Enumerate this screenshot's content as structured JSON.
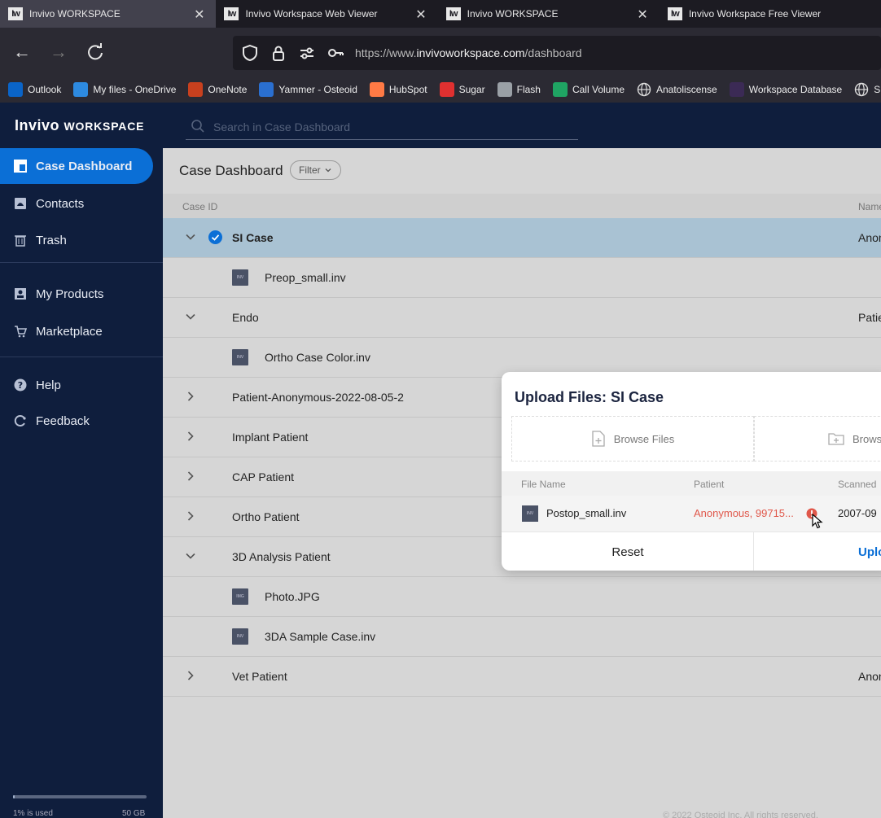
{
  "browser": {
    "tabs": [
      {
        "favicon": "Iw",
        "label": "Invivo WORKSPACE",
        "active": true
      },
      {
        "favicon": "Iw",
        "label": "Invivo Workspace Web Viewer",
        "active": false
      },
      {
        "favicon": "Iw",
        "label": "Invivo WORKSPACE",
        "active": false
      },
      {
        "favicon": "Iw",
        "label": "Invivo Workspace Free Viewer",
        "active": false
      }
    ],
    "url_prefix": "https://www.",
    "url_domain": "invivoworkspace.com",
    "url_path": "/dashboard",
    "bookmarks": [
      {
        "label": "Outlook",
        "color": "#0a64c8",
        "icon": "outlook-icon"
      },
      {
        "label": "My files - OneDrive",
        "color": "#2d8ae0",
        "icon": "onedrive-icon"
      },
      {
        "label": "OneNote",
        "color": "#c8401e",
        "icon": "onenote-icon"
      },
      {
        "label": "Yammer - Osteoid",
        "color": "#2a6fd0",
        "icon": "yammer-icon"
      },
      {
        "label": "HubSpot",
        "color": "#ff7a45",
        "icon": "hubspot-icon"
      },
      {
        "label": "Sugar",
        "color": "#e03030",
        "icon": "sugar-icon"
      },
      {
        "label": "Flash",
        "color": "#9aa0a6",
        "icon": "flash-icon"
      },
      {
        "label": "Call Volume",
        "color": "#1fa463",
        "icon": "sheets-icon"
      },
      {
        "label": "Anatoliscense",
        "color": "transparent",
        "icon": "globe-icon"
      },
      {
        "label": "Workspace Database",
        "color": "#3b2a55",
        "icon": "database-icon"
      },
      {
        "label": "Surg",
        "color": "transparent",
        "icon": "globe-icon"
      }
    ]
  },
  "app": {
    "logo_main": "Invivo",
    "logo_sub": "WORKSPACE",
    "search_placeholder": "Search in Case Dashboard"
  },
  "sidebar": {
    "items": [
      {
        "label": "Case Dashboard",
        "icon": "dashboard-icon",
        "active": true
      },
      {
        "label": "Contacts",
        "icon": "contacts-icon"
      },
      {
        "label": "Trash",
        "icon": "trash-icon"
      },
      {
        "label": "My Products",
        "icon": "products-icon"
      },
      {
        "label": "Marketplace",
        "icon": "cart-icon"
      },
      {
        "label": "Help",
        "icon": "help-icon"
      },
      {
        "label": "Feedback",
        "icon": "feedback-icon"
      }
    ],
    "storage_used": "1% is used",
    "storage_used_fraction": 0.01,
    "storage_total": "50 GB"
  },
  "dashboard": {
    "title": "Case Dashboard",
    "filter_label": "Filter",
    "col_case_id": "Case ID",
    "col_name": "Name",
    "rows": [
      {
        "kind": "case",
        "label": "SI Case",
        "expanded": true,
        "selected": true,
        "name": "Anonymous"
      },
      {
        "kind": "file",
        "label": "Preop_small.inv",
        "badge": "INV",
        "name": ""
      },
      {
        "kind": "case",
        "label": "Endo",
        "expanded": true,
        "name": "Patient"
      },
      {
        "kind": "file",
        "label": "Ortho Case Color.inv",
        "badge": "INV",
        "name": ""
      },
      {
        "kind": "case",
        "label": "Patient-Anonymous-2022-08-05-2",
        "expanded": false,
        "name": ""
      },
      {
        "kind": "case",
        "label": "Implant Patient",
        "expanded": false,
        "name": ""
      },
      {
        "kind": "case",
        "label": "CAP Patient",
        "expanded": false,
        "name": ""
      },
      {
        "kind": "case",
        "label": "Ortho Patient",
        "expanded": false,
        "name": ""
      },
      {
        "kind": "case",
        "label": "3D Analysis Patient",
        "expanded": true,
        "name": ""
      },
      {
        "kind": "file",
        "label": "Photo.JPG",
        "badge": "IMG",
        "name": ""
      },
      {
        "kind": "file",
        "label": "3DA Sample Case.inv",
        "badge": "INV",
        "name": ""
      },
      {
        "kind": "case",
        "label": "Vet Patient",
        "expanded": false,
        "name": "Anonymous"
      }
    ],
    "footer": "© 2022 Osteoid Inc. All rights reserved."
  },
  "upload_modal": {
    "title": "Upload Files: SI Case",
    "browse_files": "Browse Files",
    "browse_folder": "Browse Folder",
    "col_file_name": "File Name",
    "col_patient": "Patient",
    "col_scanned": "Scanned",
    "file": {
      "name": "Postop_small.inv",
      "badge": "INV",
      "patient": "Anonymous, 99715...",
      "scanned": "2007-09"
    },
    "reset_label": "Reset",
    "upload_label": "Upload",
    "warning_color": "#e0574a",
    "accent_color": "#0b6fd6"
  }
}
